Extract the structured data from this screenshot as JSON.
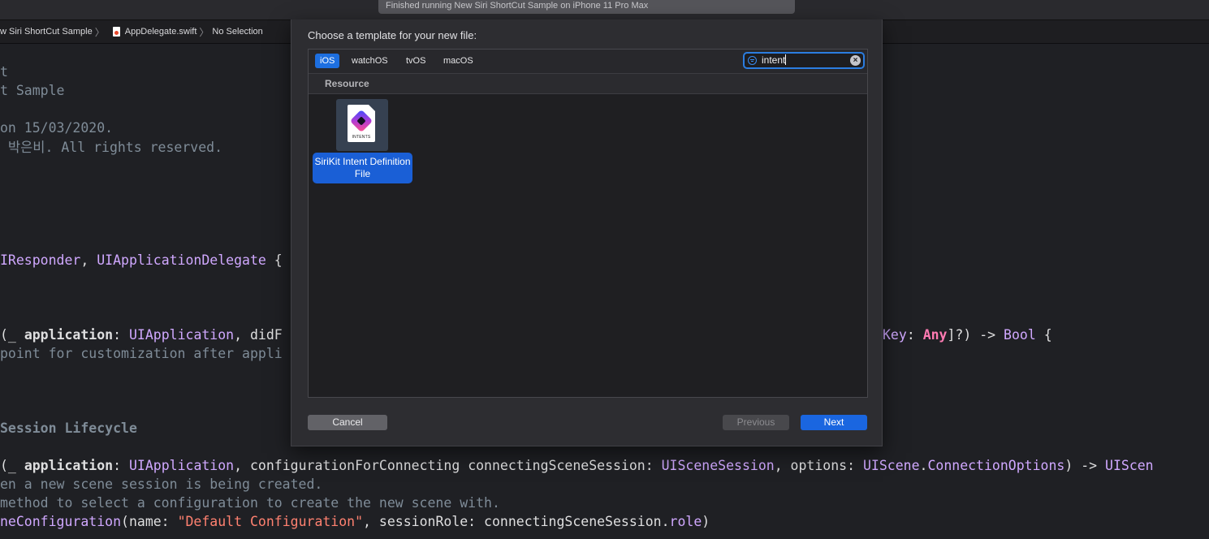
{
  "status_bar": {
    "text": "Finished running New Siri ShortCut Sample on iPhone 11 Pro Max"
  },
  "breadcrumb": {
    "project": "w Siri ShortCut Sample",
    "file": "AppDelegate.swift",
    "selection": "No Selection",
    "separator": "〉"
  },
  "editor": {
    "lines": {
      "l1": "t",
      "l2": "t Sample",
      "l3": "on 15/03/2020.",
      "l4": " 박은비. All rights reserved.",
      "l5a": "IResponder",
      "l5b": ", ",
      "l5c": "UIApplicationDelegate",
      "l5d": " {",
      "l6a": "(_ ",
      "l6b": "application",
      "l6c": ": ",
      "l6d": "UIApplication",
      "l6e": ", didF",
      "l6f": "Key",
      "l6g": ": ",
      "l6h": "Any",
      "l6i": "]?) -> ",
      "l6j": "Bool",
      "l6k": " {",
      "l7": "point for customization after appli",
      "l8": "Session Lifecycle",
      "l9a": "(_ ",
      "l9b": "application",
      "l9c": ": ",
      "l9d": "UIApplication",
      "l9e": ", configurationForConnecting connectingSceneSession: ",
      "l9f": "UISceneSession",
      "l9g": ", options: ",
      "l9h": "UIScene",
      "l9i": ".",
      "l9j": "ConnectionOptions",
      "l9k": ") -> ",
      "l9l": "UIScen",
      "l10": "en a new scene session is being created.",
      "l11": "method to select a configuration to create the new scene with.",
      "l12a": "neConfiguration",
      "l12b": "(name: ",
      "l12c": "\"Default Configuration\"",
      "l12d": ", sessionRole: connectingSceneSession.",
      "l12e": "role",
      "l12f": ")"
    }
  },
  "dialog": {
    "title": "Choose a template for your new file:",
    "tabs": [
      "iOS",
      "watchOS",
      "tvOS",
      "macOS"
    ],
    "active_tab": "iOS",
    "search": {
      "value": "intent"
    },
    "section": "Resource",
    "templates": [
      {
        "label": "SiriKit Intent Definition File",
        "icon": "intents-file-icon",
        "icon_caption": "INTENTS"
      }
    ],
    "buttons": {
      "cancel": "Cancel",
      "previous": "Previous",
      "next": "Next"
    }
  },
  "colors": {
    "accent": "#1a66e0",
    "keyword": "#ff7ab2",
    "type": "#d0a8ff",
    "string": "#ff8170",
    "comment": "#7f8c98",
    "background": "#1f2024"
  }
}
